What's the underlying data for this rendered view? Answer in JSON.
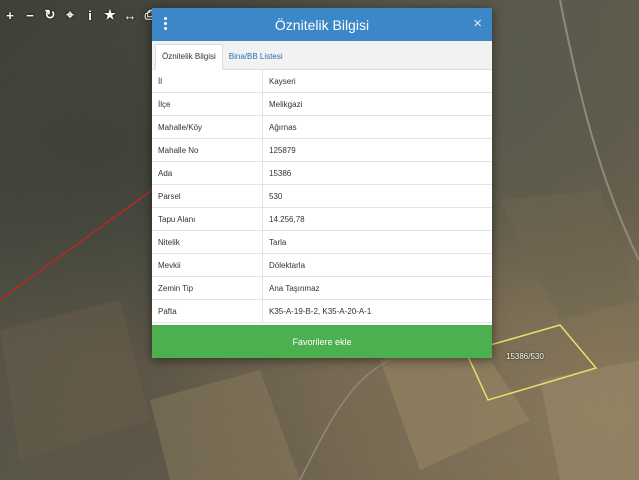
{
  "toolbar": {
    "items": [
      {
        "name": "plus-icon",
        "glyph": "+"
      },
      {
        "name": "minus-icon",
        "glyph": "−"
      },
      {
        "name": "refresh-icon",
        "glyph": "↻"
      },
      {
        "name": "locate-icon",
        "glyph": "⌖"
      },
      {
        "name": "info-icon",
        "glyph": "i"
      },
      {
        "name": "star-icon",
        "glyph": "★"
      },
      {
        "name": "measure-icon",
        "glyph": "↔"
      },
      {
        "name": "print-icon",
        "glyph": "⎙"
      }
    ]
  },
  "modal": {
    "title": "Öznitelik Bilgisi",
    "close_glyph": "×",
    "tabs": [
      "Öznitelik Bilgisi",
      "Bina/BB Listesi"
    ],
    "rows": [
      {
        "key": "İl",
        "value": "Kayseri"
      },
      {
        "key": "İlçe",
        "value": "Melikgazi"
      },
      {
        "key": "Mahalle/Köy",
        "value": "Ağırnas"
      },
      {
        "key": "Mahalle No",
        "value": "125879"
      },
      {
        "key": "Ada",
        "value": "15386"
      },
      {
        "key": "Parsel",
        "value": "530"
      },
      {
        "key": "Tapu Alanı",
        "value": "14.256,78"
      },
      {
        "key": "Nitelik",
        "value": "Tarla"
      },
      {
        "key": "Mevkii",
        "value": "Dölektarla"
      },
      {
        "key": "Zemin Tip",
        "value": "Ana Taşınmaz"
      },
      {
        "key": "Pafta",
        "value": "K35-A-19-B-2, K35-A-20-A-1"
      }
    ],
    "favorite_button": "Favorilere ekle"
  },
  "map": {
    "parcel_label": "15386/530",
    "parcel_outline_color": "#e8e06a",
    "line_color": "#d02020"
  },
  "colors": {
    "header": "#3b87c8",
    "button": "#4caf50"
  }
}
